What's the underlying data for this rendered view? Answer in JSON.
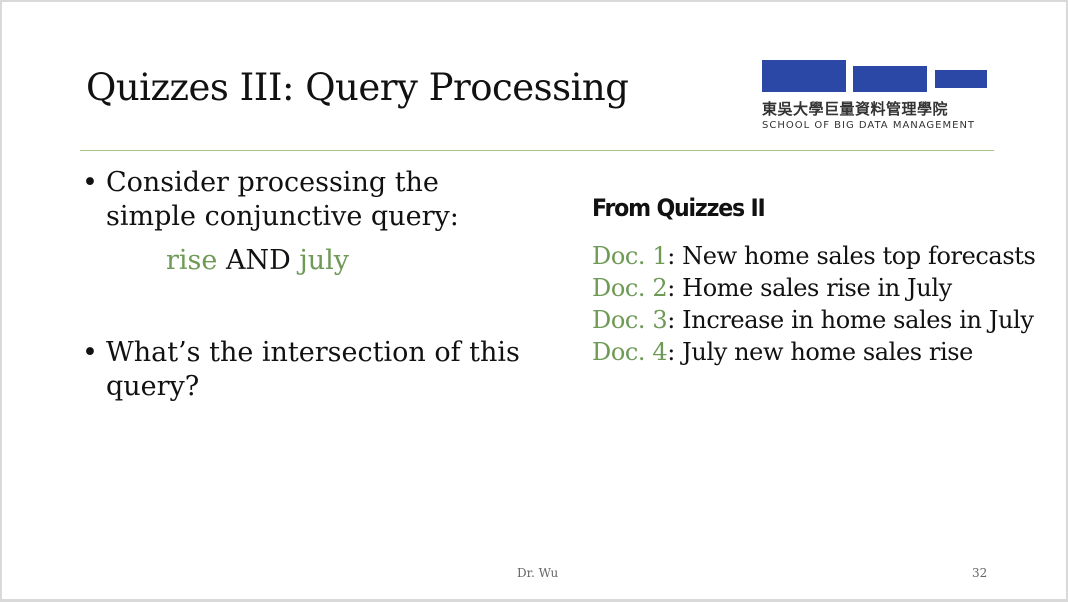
{
  "slide": {
    "title": "Quizzes III: Query Processing",
    "logo": {
      "chinese_name": "東吳大學巨量資料管理學院",
      "english_name": "SCHOOL OF BIG DATA MANAGEMENT"
    },
    "bullets": [
      {
        "text": "Consider processing the simple conjunctive query:"
      },
      {
        "text": "What’s the intersection of this query?"
      }
    ],
    "query": {
      "term1": "rise",
      "operator": " AND ",
      "term2": "july"
    },
    "bullet_glyph": "•",
    "panel": {
      "title": "From Quizzes II",
      "documents": [
        {
          "label": "Doc. 1",
          "text": ": New home sales top forecasts"
        },
        {
          "label": "Doc. 2",
          "text": ": Home sales rise in July"
        },
        {
          "label": "Doc. 3",
          "text": ": Increase in home sales in July"
        },
        {
          "label": "Doc. 4",
          "text": ": July new home sales rise"
        }
      ]
    },
    "footer": "Dr. Wu",
    "page_number": "32",
    "colors": {
      "accent_green": "#6e9a56",
      "logo_blue": "#2c48a6",
      "rule_green": "#a7c489"
    }
  }
}
